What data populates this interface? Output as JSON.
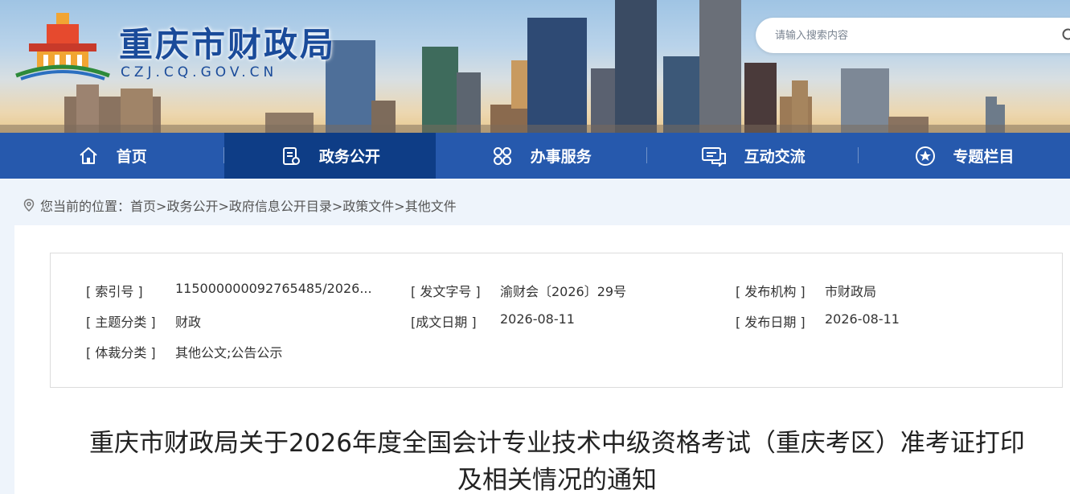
{
  "site": {
    "name": "重庆市财政局",
    "domain": "CZJ.CQ.GOV.CN"
  },
  "search": {
    "placeholder": "请输入搜索内容"
  },
  "nav": {
    "items": [
      {
        "label": "首页",
        "icon": "home-icon"
      },
      {
        "label": "政务公开",
        "icon": "document-icon"
      },
      {
        "label": "办事服务",
        "icon": "grid-icon"
      },
      {
        "label": "互动交流",
        "icon": "chat-icon"
      },
      {
        "label": "专题栏目",
        "icon": "star-icon"
      }
    ],
    "active_index": 1
  },
  "breadcrumb": {
    "prefix": "您当前的位置：",
    "items": [
      "首页",
      "政务公开",
      "政府信息公开目录",
      "政策文件",
      "其他文件"
    ],
    "separator": ">"
  },
  "meta": {
    "index_label": "[ 索引号 ]",
    "index_value": "115000000092765485/2026...",
    "doc_no_label": "[ 发文字号 ]",
    "doc_no_value": "渝财会〔2026〕29号",
    "publisher_label": "[ 发布机构 ]",
    "publisher_value": "市财政局",
    "topic_label": "[ 主题分类 ]",
    "topic_value": "财政",
    "created_label": "[成文日期 ]",
    "created_value": "2026-08-11",
    "published_label": "[ 发布日期 ]",
    "published_value": "2026-08-11",
    "genre_label": "[ 体裁分类 ]",
    "genre_value": "其他公文;公告公示"
  },
  "document": {
    "title_line1": "重庆市财政局关于2026年度全国会计专业技术中级资格考试（重庆考区）准考证打印",
    "title_line2": "及相关情况的通知"
  },
  "colors": {
    "nav_bg": "#2659ad",
    "nav_active": "#0e3d86",
    "brand_blue": "#1a4b9a"
  }
}
